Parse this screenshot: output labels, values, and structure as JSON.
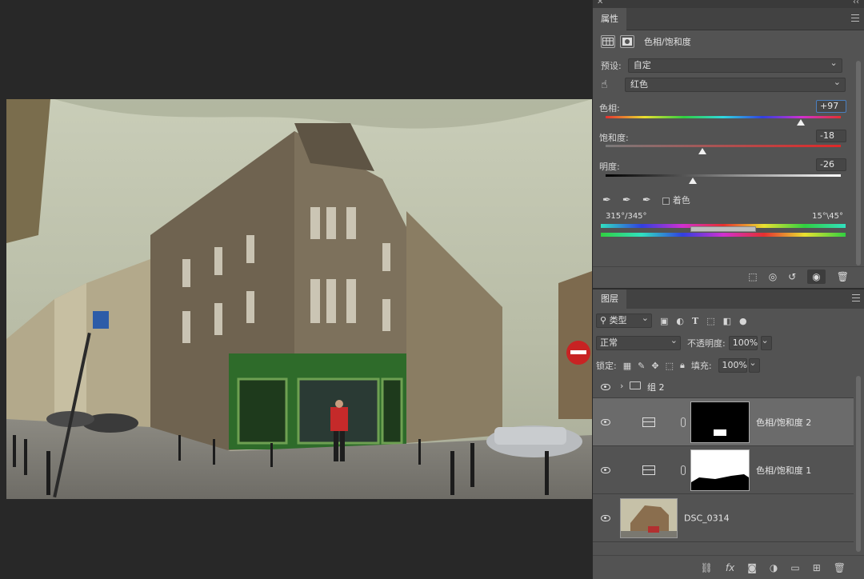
{
  "properties": {
    "tab_label": "属性",
    "title": "色相/饱和度",
    "preset_label": "预设:",
    "preset_value": "自定",
    "channel_value": "红色",
    "hue": {
      "label": "色相:",
      "value": "+97",
      "position": 0.83
    },
    "saturation": {
      "label": "饱和度:",
      "value": "-18",
      "position": 0.41
    },
    "lightness": {
      "label": "明度:",
      "value": "-26",
      "position": 0.37
    },
    "colorize_label": "着色",
    "range_left": "315°/345°",
    "range_right": "15°\\45°"
  },
  "layers": {
    "tab_label": "图层",
    "filter_label": "类型",
    "blend_mode": "正常",
    "opacity_label": "不透明度:",
    "opacity_value": "100%",
    "lock_label": "锁定:",
    "fill_label": "填充:",
    "fill_value": "100%",
    "items": [
      {
        "name": "组 2",
        "type": "group"
      },
      {
        "name": "色相/饱和度 2",
        "type": "adjustment",
        "selected": true
      },
      {
        "name": "色相/饱和度 1",
        "type": "adjustment",
        "selected": false
      },
      {
        "name": "DSC_0314",
        "type": "image"
      }
    ]
  },
  "icons": {
    "eye": "eye-icon",
    "folder": "folder-icon",
    "link": "link-icon",
    "trash": "trash-icon"
  },
  "colors": {
    "panel_bg": "#535353",
    "canvas_bg": "#282828",
    "accent": "#4a7fbf"
  }
}
